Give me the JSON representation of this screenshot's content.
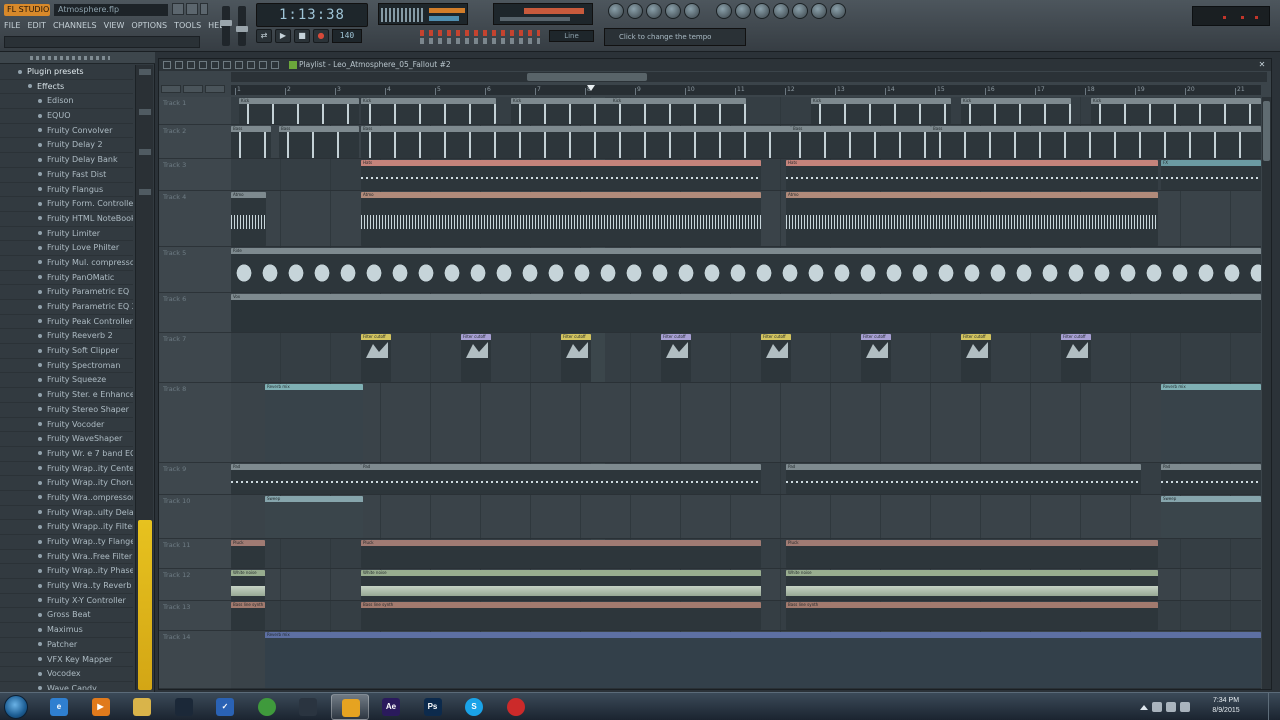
{
  "app": {
    "logo_text": "FL STUDIO",
    "project_name": "Atmosphere.flp",
    "menu": [
      "FILE",
      "EDIT",
      "CHANNELS",
      "VIEW",
      "OPTIONS",
      "TOOLS",
      "HELP"
    ],
    "time_display": "1:13:38",
    "tempo": "140",
    "song_pos": "Line",
    "hint": "Click to change the tempo"
  },
  "browser": {
    "items": [
      {
        "label": "Plugin presets",
        "type": "hdr"
      },
      {
        "label": "Effects",
        "type": "folder"
      },
      {
        "label": "Edison",
        "type": "item"
      },
      {
        "label": "EQUO",
        "type": "item"
      },
      {
        "label": "Fruity Convolver",
        "type": "item"
      },
      {
        "label": "Fruity Delay 2",
        "type": "item"
      },
      {
        "label": "Fruity Delay Bank",
        "type": "item"
      },
      {
        "label": "Fruity Fast Dist",
        "type": "item"
      },
      {
        "label": "Fruity Flangus",
        "type": "item"
      },
      {
        "label": "Fruity Form. Controller",
        "type": "item"
      },
      {
        "label": "Fruity HTML NoteBook",
        "type": "item"
      },
      {
        "label": "Fruity Limiter",
        "type": "item"
      },
      {
        "label": "Fruity Love Philter",
        "type": "item"
      },
      {
        "label": "Fruity Mul. compressor",
        "type": "item"
      },
      {
        "label": "Fruity PanOMatic",
        "type": "item"
      },
      {
        "label": "Fruity Parametric EQ",
        "type": "item"
      },
      {
        "label": "Fruity Parametric EQ 2",
        "type": "item"
      },
      {
        "label": "Fruity Peak Controller",
        "type": "item"
      },
      {
        "label": "Fruity Reeverb 2",
        "type": "item"
      },
      {
        "label": "Fruity Soft Clipper",
        "type": "item"
      },
      {
        "label": "Fruity Spectroman",
        "type": "item"
      },
      {
        "label": "Fruity Squeeze",
        "type": "item"
      },
      {
        "label": "Fruity Ster. e Enhancer",
        "type": "item"
      },
      {
        "label": "Fruity Stereo Shaper",
        "type": "item"
      },
      {
        "label": "Fruity Vocoder",
        "type": "item"
      },
      {
        "label": "Fruity WaveShaper",
        "type": "item"
      },
      {
        "label": "Fruity Wr. e 7 band EQ",
        "type": "item"
      },
      {
        "label": "Fruity Wrap..ity Center",
        "type": "item"
      },
      {
        "label": "Fruity Wrap..ity Chorus",
        "type": "item"
      },
      {
        "label": "Fruity Wra..ompressor",
        "type": "item"
      },
      {
        "label": "Fruity Wrap..ulty Delay",
        "type": "item"
      },
      {
        "label": "Fruity Wrapp..ity Filter",
        "type": "item"
      },
      {
        "label": "Fruity Wrap..ty Flanger",
        "type": "item"
      },
      {
        "label": "Fruity Wra..Free Filter",
        "type": "item"
      },
      {
        "label": "Fruity Wrap..ity Phaser",
        "type": "item"
      },
      {
        "label": "Fruity Wra..ty Reverb",
        "type": "item"
      },
      {
        "label": "Fruity X-Y Controller",
        "type": "item"
      },
      {
        "label": "Gross Beat",
        "type": "item"
      },
      {
        "label": "Maximus",
        "type": "item"
      },
      {
        "label": "Patcher",
        "type": "item"
      },
      {
        "label": "VFX Key Mapper",
        "type": "item"
      },
      {
        "label": "Vocodex",
        "type": "item"
      },
      {
        "label": "Wave Candy",
        "type": "item"
      }
    ]
  },
  "playlist": {
    "title": "Playlist - Leo_Atmosphere_05_Fallout #2",
    "ruler": [
      "1",
      "2",
      "3",
      "4",
      "5",
      "6",
      "7",
      "8",
      "9",
      "10",
      "11",
      "12",
      "13",
      "14",
      "15",
      "16",
      "17",
      "18",
      "19",
      "20",
      "21"
    ],
    "tracks": [
      "Track 1",
      "Track 2",
      "Track 3",
      "Track 4",
      "Track 5",
      "Track 6",
      "Track 7",
      "Track 8",
      "Track 9",
      "Track 10",
      "Track 11",
      "Track 12",
      "Track 13",
      "Track 14"
    ],
    "clip_labels": {
      "kick": "Kick",
      "bass": "Bass",
      "hat": "Hats",
      "fx": "FX",
      "atmo": "Atmo",
      "ride": "Ride",
      "vox": "Vox",
      "filter_auto": "Filter cutoff",
      "reverb_auto": "Reverb mix",
      "pad": "Pad",
      "pluck": "Pluck",
      "noise": "White noise",
      "bass_line": "Bass line synth",
      "sweep": "Sweep"
    }
  },
  "taskbar": {
    "apps": [
      {
        "name": "internet-explorer",
        "label": "e",
        "color": "#2f7fd0"
      },
      {
        "name": "media-player",
        "label": "▶",
        "color": "#e07a1c"
      },
      {
        "name": "file-explorer",
        "label": "",
        "color": "#d9b44a"
      },
      {
        "name": "steam",
        "label": "",
        "color": "#1b2838"
      },
      {
        "name": "task-tool",
        "label": "✓",
        "color": "#2a62b4"
      },
      {
        "name": "chrome",
        "label": "",
        "color": "#3f9a3c"
      },
      {
        "name": "screen-recorder",
        "label": "",
        "color": "#2a3440"
      },
      {
        "name": "fl-studio",
        "label": "",
        "color": "#e6a321"
      },
      {
        "name": "after-effects",
        "label": "Ae",
        "color": "#2a1a5c"
      },
      {
        "name": "photoshop",
        "label": "Ps",
        "color": "#0c2a4c"
      },
      {
        "name": "skype",
        "label": "S",
        "color": "#1aa3e8"
      },
      {
        "name": "record-app",
        "label": "",
        "color": "#cc2a2a"
      }
    ],
    "time": "7:34 PM",
    "date": "8/9/2015"
  },
  "colors": {
    "accent_yellow": "#e7c21f",
    "fl_orange": "#d8892a",
    "track_bg": "#353e44"
  }
}
